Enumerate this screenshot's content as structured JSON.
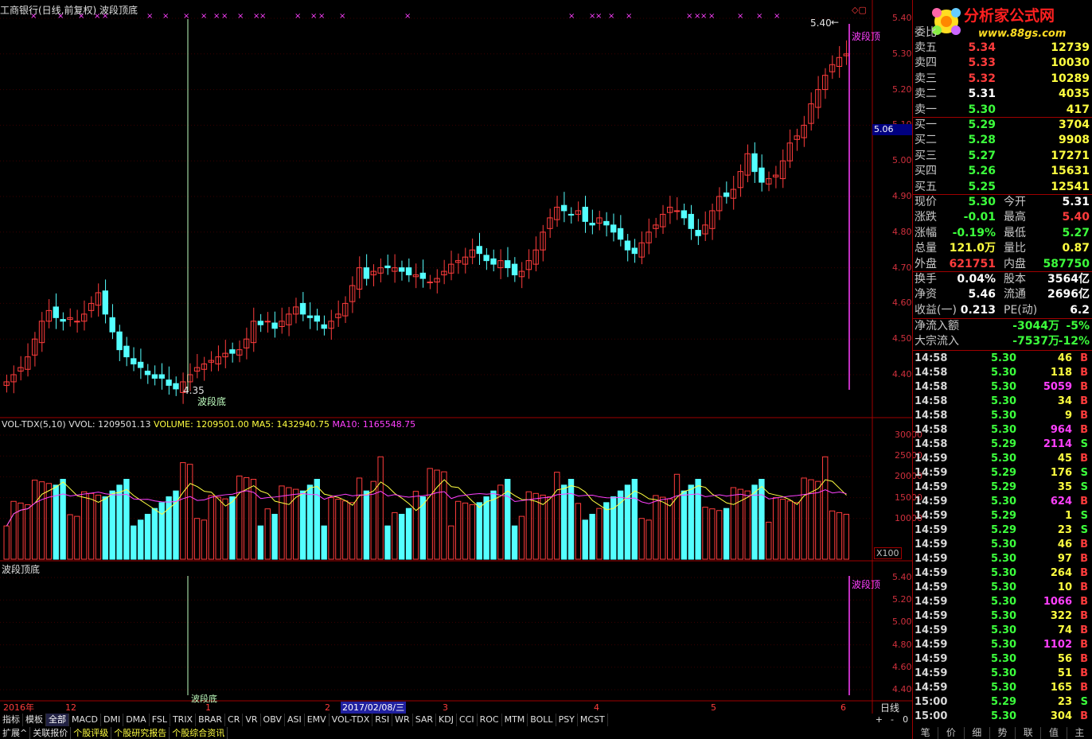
{
  "title": "工商银行(日线,前复权) 波段顶底",
  "main_chart": {
    "price_axis": [
      "5.40",
      "5.30",
      "5.20",
      "5.10",
      "5.00",
      "4.90",
      "4.80",
      "4.70",
      "4.60",
      "4.50",
      "4.40"
    ],
    "current_price_tag": "5.06",
    "high_mark": "5.40",
    "low_mark": "4.35",
    "top_signal": "波段顶",
    "bottom_signal": "波段底"
  },
  "volume_chart": {
    "header": {
      "name": "VOL-TDX(5,10)",
      "vvol": "VVOL: 1209501.13",
      "volume": "VOLUME: 1209501.00",
      "ma5": "MA5: 1432940.75",
      "ma10": "MA10: 1165548.75"
    },
    "axis": [
      "30000",
      "25000",
      "20000",
      "15000",
      "10000"
    ],
    "unit": "X100"
  },
  "indicator_chart": {
    "name": "波段顶底",
    "axis": [
      "5.40",
      "5.20",
      "5.00",
      "4.80",
      "4.60",
      "4.40"
    ],
    "top_signal": "波段顶",
    "bottom_signal": "波段底"
  },
  "date_bar": {
    "year": "2016年",
    "months": [
      "12",
      "1",
      "2",
      "3",
      "4",
      "5",
      "6"
    ],
    "selected_date": "2017/02/08/三",
    "period": "日线"
  },
  "indicator_tabs": [
    "指标",
    "模板",
    "全部",
    "MACD",
    "DMI",
    "DMA",
    "FSL",
    "TRIX",
    "BRAR",
    "CR",
    "VR",
    "OBV",
    "ASI",
    "EMV",
    "VOL-TDX",
    "RSI",
    "WR",
    "SAR",
    "KDJ",
    "CCI",
    "ROC",
    "MTM",
    "BOLL",
    "PSY",
    "MCST"
  ],
  "zoom_controls": [
    "+",
    "-",
    "0"
  ],
  "bottom_links": [
    "扩展^",
    "关联报价",
    "个股评级",
    "个股研究报告",
    "个股综合资讯"
  ],
  "logo": {
    "name": "分析家公式网",
    "url": "www.88gs.com"
  },
  "quote_panel": {
    "weibi_label": "委比",
    "asks": [
      {
        "label": "卖五",
        "price": "5.34",
        "vol": "12739",
        "color": "#ff3c3c"
      },
      {
        "label": "卖四",
        "price": "5.33",
        "vol": "10030",
        "color": "#ff3c3c"
      },
      {
        "label": "卖三",
        "price": "5.32",
        "vol": "10289",
        "color": "#ff3c3c"
      },
      {
        "label": "卖二",
        "price": "5.31",
        "vol": "4035",
        "color": "#ffffff"
      },
      {
        "label": "卖一",
        "price": "5.30",
        "vol": "417",
        "color": "#3cff3c"
      }
    ],
    "bids": [
      {
        "label": "买一",
        "price": "5.29",
        "vol": "3704",
        "color": "#3cff3c"
      },
      {
        "label": "买二",
        "price": "5.28",
        "vol": "9908",
        "color": "#3cff3c"
      },
      {
        "label": "买三",
        "price": "5.27",
        "vol": "17271",
        "color": "#3cff3c"
      },
      {
        "label": "买四",
        "price": "5.26",
        "vol": "15631",
        "color": "#3cff3c"
      },
      {
        "label": "买五",
        "price": "5.25",
        "vol": "12541",
        "color": "#3cff3c"
      }
    ],
    "stats": [
      {
        "l1": "现价",
        "v1": "5.30",
        "c1": "#3cff3c",
        "l2": "今开",
        "v2": "5.31",
        "c2": "#ffffff"
      },
      {
        "l1": "涨跌",
        "v1": "-0.01",
        "c1": "#3cff3c",
        "l2": "最高",
        "v2": "5.40",
        "c2": "#ff3c3c"
      },
      {
        "l1": "涨幅",
        "v1": "-0.19%",
        "c1": "#3cff3c",
        "l2": "最低",
        "v2": "5.27",
        "c2": "#3cff3c"
      },
      {
        "l1": "总量",
        "v1": "121.0万",
        "c1": "#ffff40",
        "l2": "量比",
        "v2": "0.87",
        "c2": "#ffff40"
      },
      {
        "l1": "外盘",
        "v1": "621751",
        "c1": "#ff3c3c",
        "l2": "内盘",
        "v2": "587750",
        "c2": "#3cff3c"
      }
    ],
    "stats2": [
      {
        "l1": "换手",
        "v1": "0.04%",
        "c1": "#ffffff",
        "l2": "股本",
        "v2": "3564亿",
        "c2": "#ffffff"
      },
      {
        "l1": "净资",
        "v1": "5.46",
        "c1": "#ffffff",
        "l2": "流通",
        "v2": "2696亿",
        "c2": "#ffffff"
      },
      {
        "l1": "收益(一)",
        "v1": "0.213",
        "c1": "#ffffff",
        "l2": "PE(动)",
        "v2": "6.2",
        "c2": "#ffffff"
      }
    ],
    "flows": [
      {
        "label": "净流入额",
        "value": "-3044万",
        "pct": "-5%"
      },
      {
        "label": "大宗流入",
        "value": "-7537万",
        "pct": "-12%"
      }
    ],
    "ticks": [
      {
        "t": "14:58",
        "p": "5.30",
        "v": "46",
        "bs": "B",
        "big": false
      },
      {
        "t": "14:58",
        "p": "5.30",
        "v": "118",
        "bs": "B",
        "big": false
      },
      {
        "t": "14:58",
        "p": "5.30",
        "v": "5059",
        "bs": "B",
        "big": true
      },
      {
        "t": "14:58",
        "p": "5.30",
        "v": "34",
        "bs": "B",
        "big": false
      },
      {
        "t": "14:58",
        "p": "5.30",
        "v": "9",
        "bs": "B",
        "big": false
      },
      {
        "t": "14:58",
        "p": "5.30",
        "v": "964",
        "bs": "B",
        "big": true
      },
      {
        "t": "14:58",
        "p": "5.29",
        "v": "2114",
        "bs": "S",
        "big": true
      },
      {
        "t": "14:59",
        "p": "5.30",
        "v": "45",
        "bs": "B",
        "big": false
      },
      {
        "t": "14:59",
        "p": "5.29",
        "v": "176",
        "bs": "S",
        "big": false
      },
      {
        "t": "14:59",
        "p": "5.29",
        "v": "35",
        "bs": "S",
        "big": false
      },
      {
        "t": "14:59",
        "p": "5.30",
        "v": "624",
        "bs": "B",
        "big": true
      },
      {
        "t": "14:59",
        "p": "5.29",
        "v": "1",
        "bs": "S",
        "big": false
      },
      {
        "t": "14:59",
        "p": "5.29",
        "v": "23",
        "bs": "S",
        "big": false
      },
      {
        "t": "14:59",
        "p": "5.30",
        "v": "46",
        "bs": "B",
        "big": false
      },
      {
        "t": "14:59",
        "p": "5.30",
        "v": "97",
        "bs": "B",
        "big": false
      },
      {
        "t": "14:59",
        "p": "5.30",
        "v": "264",
        "bs": "B",
        "big": false
      },
      {
        "t": "14:59",
        "p": "5.30",
        "v": "10",
        "bs": "B",
        "big": false
      },
      {
        "t": "14:59",
        "p": "5.30",
        "v": "1066",
        "bs": "B",
        "big": true
      },
      {
        "t": "14:59",
        "p": "5.30",
        "v": "322",
        "bs": "B",
        "big": false
      },
      {
        "t": "14:59",
        "p": "5.30",
        "v": "74",
        "bs": "B",
        "big": false
      },
      {
        "t": "14:59",
        "p": "5.30",
        "v": "1102",
        "bs": "B",
        "big": true
      },
      {
        "t": "14:59",
        "p": "5.30",
        "v": "56",
        "bs": "B",
        "big": false
      },
      {
        "t": "14:59",
        "p": "5.30",
        "v": "51",
        "bs": "B",
        "big": false
      },
      {
        "t": "14:59",
        "p": "5.30",
        "v": "165",
        "bs": "B",
        "big": false
      },
      {
        "t": "15:00",
        "p": "5.29",
        "v": "23",
        "bs": "S",
        "big": false
      },
      {
        "t": "15:00",
        "p": "5.30",
        "v": "304",
        "bs": "B",
        "big": false
      }
    ],
    "bottom_tabs": [
      "笔",
      "价",
      "细",
      "势",
      "联",
      "值",
      "主"
    ]
  },
  "colors": {
    "up": "#ff3c3c",
    "down": "#54ffff",
    "grid": "#a00000",
    "ma5": "#ffff40",
    "ma10": "#ff40ff"
  }
}
